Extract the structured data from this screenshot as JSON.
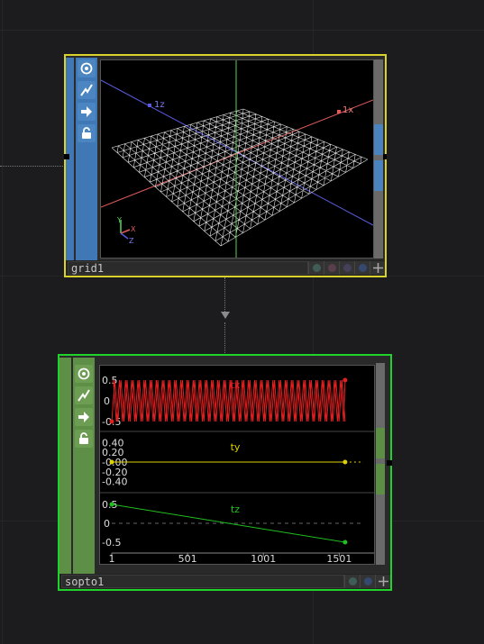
{
  "sop_node": {
    "name": "grid1",
    "axes": {
      "z_label": "1z",
      "x_label": "1x"
    },
    "gizmo": {
      "x": "X",
      "y": "Y",
      "z": "Z"
    },
    "flag_colors": [
      "#3f5d56",
      "#5a3f4a",
      "#44405a",
      "#35496e"
    ]
  },
  "chop_node": {
    "name": "sopto1",
    "flag_colors": [
      "#3f5d56",
      "#35496e"
    ],
    "channels": [
      {
        "name": "tx",
        "color": "#e02020",
        "ticks": [
          "0.5",
          "0",
          "-0.5"
        ]
      },
      {
        "name": "ty",
        "color": "#e0d000",
        "ticks": [
          "0.40",
          "0.20",
          "-0.00",
          "-0.20",
          "-0.40"
        ]
      },
      {
        "name": "tz",
        "color": "#20c020",
        "ticks": [
          "0.5",
          "0",
          "-0.5"
        ]
      }
    ],
    "x_ticks": [
      "1",
      "501",
      "1001",
      "1501"
    ]
  },
  "chart_data": {
    "type": "line",
    "x": [
      1,
      1600
    ],
    "x_ticks": [
      1,
      501,
      1001,
      1501
    ],
    "series": [
      {
        "name": "tx",
        "pattern": "triangle oscillation",
        "min": -0.5,
        "max": 0.5,
        "cycles": 38
      },
      {
        "name": "ty",
        "values": [
          0.0,
          0.0
        ]
      },
      {
        "name": "tz",
        "values": [
          0.5,
          -0.5
        ]
      }
    ]
  }
}
